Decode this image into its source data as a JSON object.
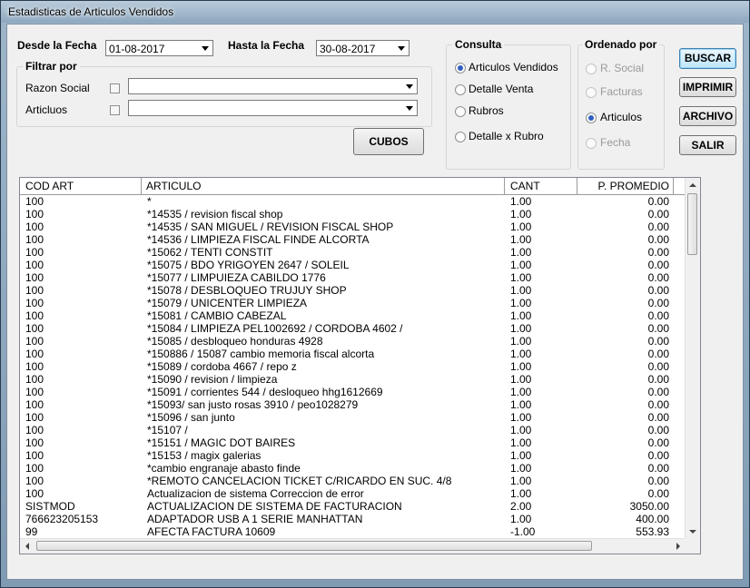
{
  "window": {
    "title": "Estadisticas de Articulos Vendidos"
  },
  "dates": {
    "desde_label": "Desde la Fecha",
    "desde_value": "01-08-2017",
    "hasta_label": "Hasta la Fecha",
    "hasta_value": "30-08-2017"
  },
  "filtrar": {
    "title": "Filtrar por",
    "razon_label": "Razon Social",
    "articulos_label": "Articluos",
    "razon_value": "",
    "articulos_value": ""
  },
  "consulta": {
    "title": "Consulta",
    "options": [
      "Articulos Vendidos",
      "Detalle Venta",
      "Rubros",
      "Detalle x Rubro"
    ],
    "selected": "Articulos Vendidos"
  },
  "ordenado": {
    "title": "Ordenado por",
    "options": [
      "R. Social",
      "Facturas",
      "Articulos",
      "Fecha"
    ],
    "selected": "Articulos"
  },
  "buttons": {
    "buscar": "BUSCAR",
    "imprimir": "IMPRIMIR",
    "archivo": "ARCHIVO",
    "salir": "SALIR",
    "cubos": "CUBOS"
  },
  "table": {
    "columns": [
      "COD ART",
      "ARTICULO",
      "CANT",
      "P. PROMEDIO"
    ],
    "rows": [
      [
        "100",
        "*",
        "1.00",
        "0.00"
      ],
      [
        "100",
        "*14535 / revision fiscal shop",
        "1.00",
        "0.00"
      ],
      [
        "100",
        "*14535 / SAN MIGUEL / REVISION FISCAL SHOP",
        "1.00",
        "0.00"
      ],
      [
        "100",
        "*14536 /  LIMPIEZA FISCAL FINDE ALCORTA",
        "1.00",
        "0.00"
      ],
      [
        "100",
        "*15062 / TENTI CONSTIT",
        "1.00",
        "0.00"
      ],
      [
        "100",
        "*15075 / BDO YRIGOYEN 2647 / SOLEIL",
        "1.00",
        "0.00"
      ],
      [
        "100",
        "*15077 / LIMPUIEZA CABILDO 1776",
        "1.00",
        "0.00"
      ],
      [
        "100",
        "*15078 / DESBLOQUEO TRUJUY SHOP",
        "1.00",
        "0.00"
      ],
      [
        "100",
        "*15079 / UNICENTER LIMPIEZA",
        "1.00",
        "0.00"
      ],
      [
        "100",
        "*15081 / CAMBIO CABEZAL",
        "1.00",
        "0.00"
      ],
      [
        "100",
        "*15084 / LIMPIEZA PEL1002692 / CORDOBA 4602 /",
        "1.00",
        "0.00"
      ],
      [
        "100",
        "*15085 / desbloqueo honduras 4928",
        "1.00",
        "0.00"
      ],
      [
        "100",
        "*150886 / 15087 cambio memoria fiscal alcorta",
        "1.00",
        "0.00"
      ],
      [
        "100",
        "*15089 / cordoba 4667 / repo z",
        "1.00",
        "0.00"
      ],
      [
        "100",
        "*15090 / revision / limpieza",
        "1.00",
        "0.00"
      ],
      [
        "100",
        "*15091 / corrientes 544 / desloqueo hhg1612669",
        "1.00",
        "0.00"
      ],
      [
        "100",
        "*15093/ san justo rosas 3910 / peo1028279",
        "1.00",
        "0.00"
      ],
      [
        "100",
        "*15096 / san junto",
        "1.00",
        "0.00"
      ],
      [
        "100",
        "*15107 /",
        "1.00",
        "0.00"
      ],
      [
        "100",
        "*15151 / MAGIC DOT BAIRES",
        "1.00",
        "0.00"
      ],
      [
        "100",
        "*15153 / magix galerias",
        "1.00",
        "0.00"
      ],
      [
        "100",
        "*cambio engranaje abasto finde",
        "1.00",
        "0.00"
      ],
      [
        "100",
        "*REMOTO CANCELACION TICKET C/RICARDO EN SUC. 4/8",
        "1.00",
        "0.00"
      ],
      [
        "100",
        "Actualizacion de sistema Correccion de error",
        "1.00",
        "0.00"
      ],
      [
        "SISTMOD",
        "ACTUALIZACION DE SISTEMA DE FACTURACION",
        "2.00",
        "3050.00"
      ],
      [
        "766623205153",
        "ADAPTADOR USB A 1 SERIE MANHATTAN",
        "1.00",
        "400.00"
      ],
      [
        "99",
        "AFECTA FACTURA   10609",
        "-1.00",
        "553.93"
      ]
    ]
  }
}
